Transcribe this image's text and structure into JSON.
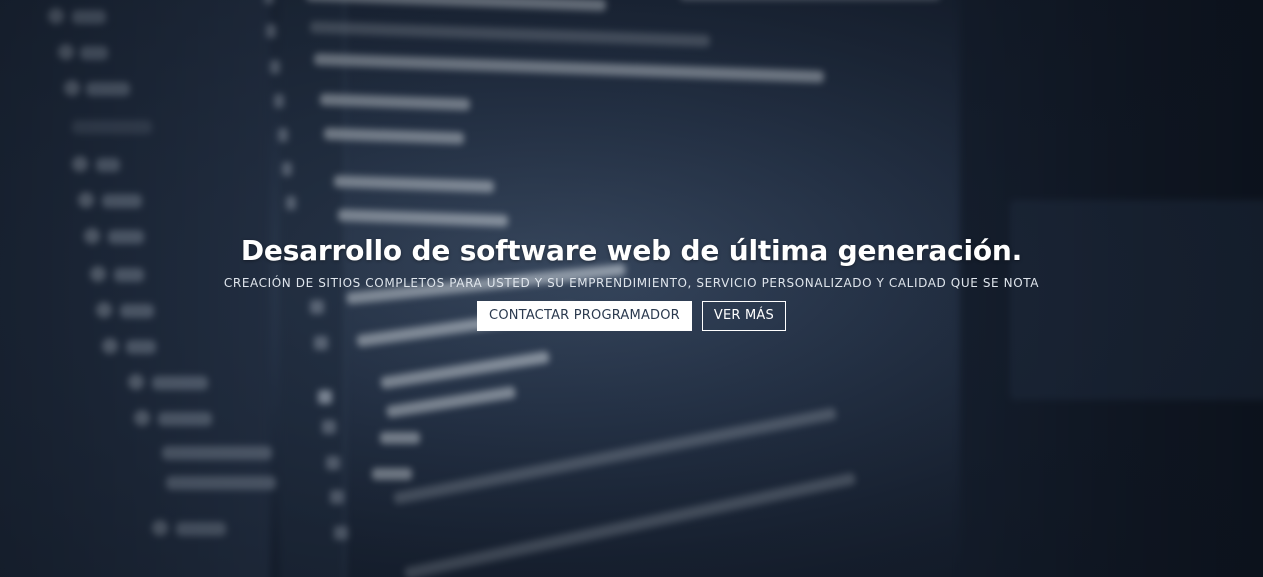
{
  "hero": {
    "title": "Desarrollo de software web de última generación.",
    "subtitle": "CREACIÓN DE SITIOS COMPLETOS PARA USTED Y SU EMPRENDIMIENTO, SERVICIO PERSONALIZADO Y CALIDAD QUE SE NOTA",
    "buttons": {
      "contact_label": "CONTACTAR PROGRAMADOR",
      "more_label": "VER MÁS"
    }
  },
  "background": {
    "description_icon": "blurred-code-editor-image",
    "line_numbers": [
      "3",
      "4",
      "5",
      "6",
      "7",
      "8",
      "9",
      "10",
      "11",
      "12",
      "13",
      "14",
      "15",
      "16",
      "17",
      "18",
      "19",
      "20",
      "21"
    ]
  },
  "colors": {
    "overlay": "#2c3b52",
    "primary_button_bg": "#ffffff",
    "primary_button_text": "#2b3a4f",
    "text": "#ffffff"
  }
}
